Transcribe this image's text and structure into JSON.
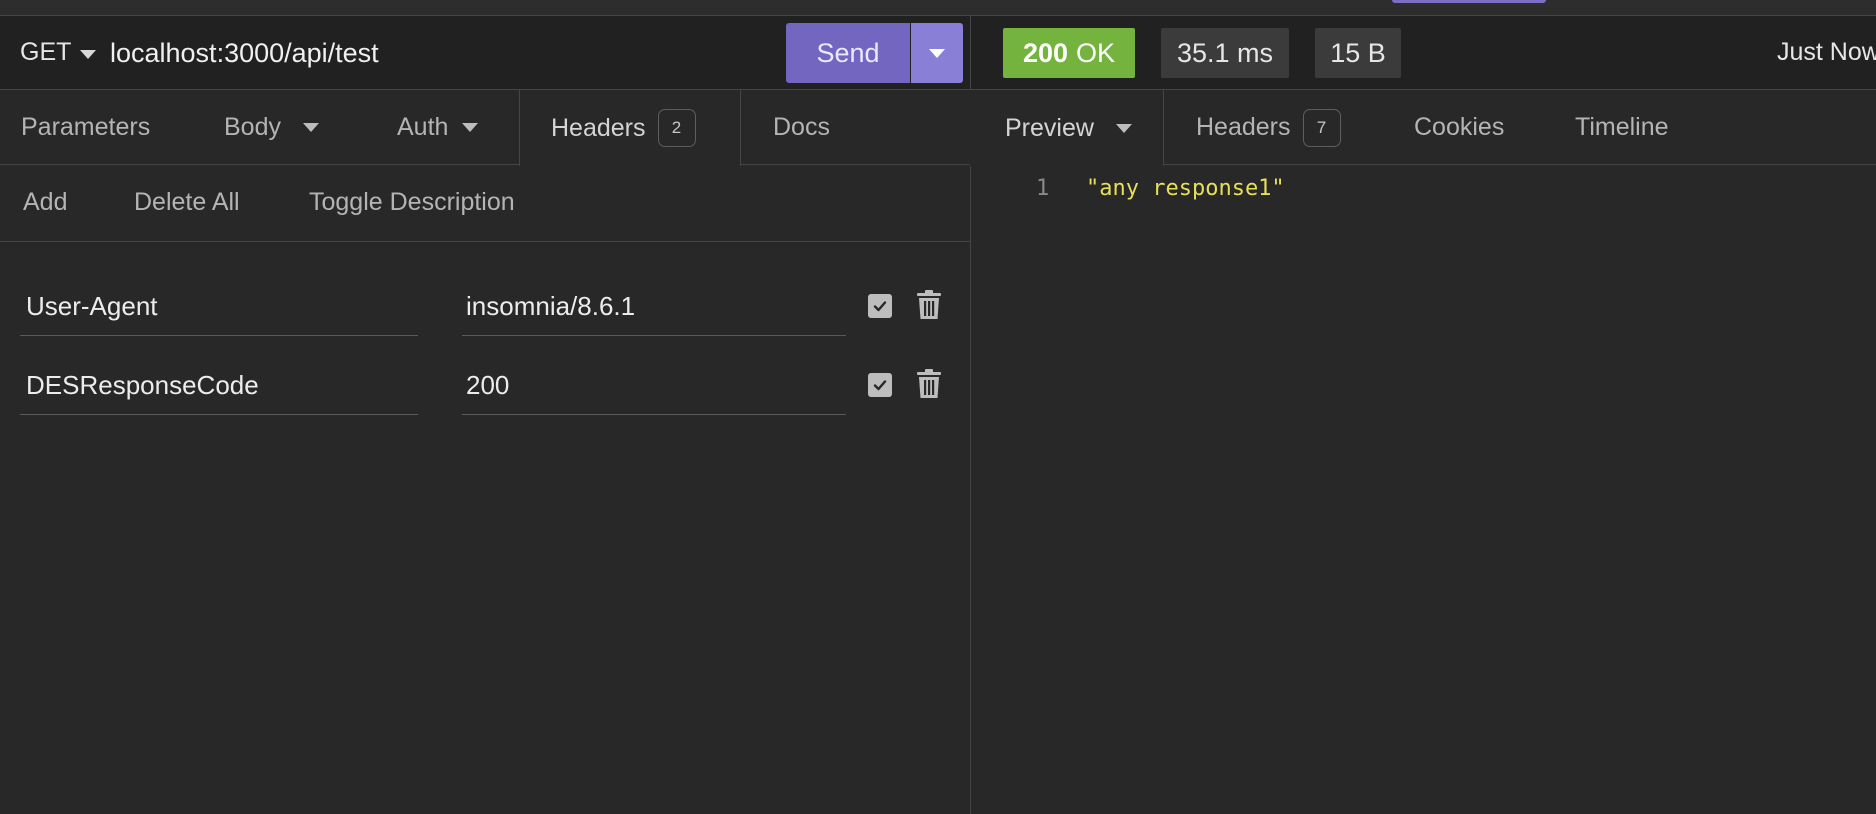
{
  "request": {
    "method": "GET",
    "url": "localhost:3000/api/test",
    "send_label": "Send",
    "tabs": [
      {
        "label": "Parameters"
      },
      {
        "label": "Body"
      },
      {
        "label": "Auth"
      },
      {
        "label": "Headers",
        "count": "2"
      },
      {
        "label": "Docs"
      }
    ],
    "actions": {
      "add": "Add",
      "delete_all": "Delete All",
      "toggle_description": "Toggle Description"
    },
    "headers": [
      {
        "name": "User-Agent",
        "value": "insomnia/8.6.1",
        "enabled": true
      },
      {
        "name": "DESResponseCode",
        "value": "200",
        "enabled": true
      }
    ]
  },
  "response": {
    "status_code": "200",
    "status_text": "OK",
    "time": "35.1 ms",
    "size": "15 B",
    "timestamp": "Just Now",
    "tabs": [
      {
        "label": "Preview"
      },
      {
        "label": "Headers",
        "count": "7"
      },
      {
        "label": "Cookies"
      },
      {
        "label": "Timeline"
      }
    ],
    "preview": {
      "line_number": "1",
      "body": "\"any response1\""
    }
  },
  "colors": {
    "accent": "#7266c0",
    "status_ok": "#74b33e",
    "string": "#e7df5a"
  }
}
